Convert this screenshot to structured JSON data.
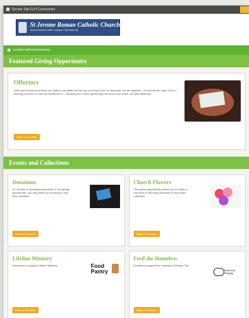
{
  "topbar": {
    "title": "Secure Site  FLH Connection"
  },
  "header": {
    "church_name": "St Jerome Roman Catholic Church",
    "church_subtitle": "Street Address  Suite  Location  City  State  Zip"
  },
  "nav": {
    "home_label": "GIVING OPPORTUNITIES"
  },
  "featured": {
    "section_title": "Featured Giving Opportunity",
    "card": {
      "title": "Offertory",
      "description": "With open hands and heart, we realize how gifted we are by our loving God. In response, we are grateful – for all that we have. Given – offering our lives to God as GENEROUS – learning from God's generosity, we serve and share our gifts selflessly.",
      "button_label": "Make a Donation"
    }
  },
  "events": {
    "section_title": "Events and Collections",
    "cards": [
      {
        "title": "Donations",
        "description": "St. Jerome is accepting donations in this giving opportunity. You may select a recurring or one-time donation.",
        "button_label": "Make a Donation"
      },
      {
        "title": "Church Flowers",
        "description": "This giving opportunity allows you to make a one-time or recurring donation to the flower collection.",
        "button_label": "Make a Donation"
      },
      {
        "title": "Lifeline Ministry",
        "description": "Donations to support Lifeline Ministry",
        "thumb_text": "Food Pantry",
        "button_label": "Make a Donation"
      },
      {
        "title": "Feed the Homeless",
        "description": "Donations support the Homeless Ministry The",
        "thumb_text": "Feed the Hungry",
        "button_label": "Make a Donation"
      }
    ]
  },
  "colors": {
    "brand_green": "#7dc242",
    "nav_green": "#5fb233",
    "button_orange": "#f2a81d",
    "logo_blue": "#2f4f85"
  }
}
